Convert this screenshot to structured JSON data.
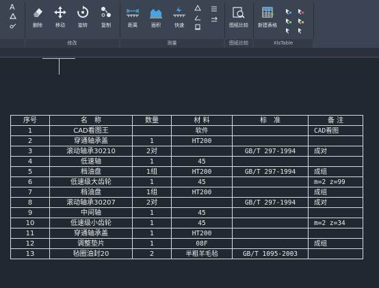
{
  "ribbon": {
    "text_icon_label": "A",
    "modify": {
      "title": "修改",
      "tools": [
        {
          "label": "删除",
          "icon": "eraser-icon"
        },
        {
          "label": "移动",
          "icon": "move-icon"
        },
        {
          "label": "旋转",
          "icon": "rotate-icon"
        },
        {
          "label": "复制",
          "icon": "copy-icon"
        }
      ]
    },
    "measure": {
      "title": "测量",
      "tools": [
        {
          "label": "距离",
          "icon": "distance-icon"
        },
        {
          "label": "面积",
          "icon": "area-icon"
        },
        {
          "label": "快速",
          "icon": "quick-measure-icon"
        }
      ]
    },
    "compare": {
      "title": "图纸比较",
      "tools": [
        {
          "label": "图纸比较",
          "icon": "drawing-compare-icon"
        }
      ]
    },
    "xlstable": {
      "title": "XlsTable",
      "tools": [
        {
          "label": "新建表格",
          "icon": "new-table-icon"
        }
      ]
    }
  },
  "bom_table": {
    "headers": [
      "序号",
      "名　称",
      "数量",
      "材 料",
      "标　准",
      "备 注"
    ],
    "rows": [
      [
        "1",
        "CAD看图王",
        "",
        "软件",
        "",
        "CAD看图"
      ],
      [
        "2",
        "穿通轴承盖",
        "1",
        "HT200",
        "",
        ""
      ],
      [
        "3",
        "滚动轴承30210",
        "2对",
        "",
        "GB/T 297-1994",
        "成对"
      ],
      [
        "4",
        "低速轴",
        "1",
        "45",
        "",
        ""
      ],
      [
        "5",
        "档油盘",
        "1组",
        "HT200",
        "GB/T 297-1994",
        "成组"
      ],
      [
        "6",
        "低速级大齿轮",
        "1",
        "45",
        "",
        "m=2 z=99"
      ],
      [
        "7",
        "档油盘",
        "1组",
        "HT200",
        "",
        "成组"
      ],
      [
        "8",
        "滚动轴承30207",
        "2对",
        "",
        "GB/T 297-1994",
        "成对"
      ],
      [
        "9",
        "中间轴",
        "1",
        "45",
        "",
        ""
      ],
      [
        "10",
        "低速级小齿轮",
        "1",
        "45",
        "",
        "m=2 z=34"
      ],
      [
        "11",
        "穿通轴承盖",
        "1",
        "HT200",
        "",
        ""
      ],
      [
        "12",
        "调整垫片",
        "1",
        "08F",
        "",
        "成组"
      ],
      [
        "13",
        "毡圈油封20",
        "2",
        "半粗羊毛毡",
        "GB/T 1095-2003",
        ""
      ]
    ]
  },
  "colors": {
    "ribbon_bg": "#3b4453",
    "canvas_bg": "#212830",
    "table_line": "#d8dce2",
    "icon_blue": "#4aa3df"
  }
}
